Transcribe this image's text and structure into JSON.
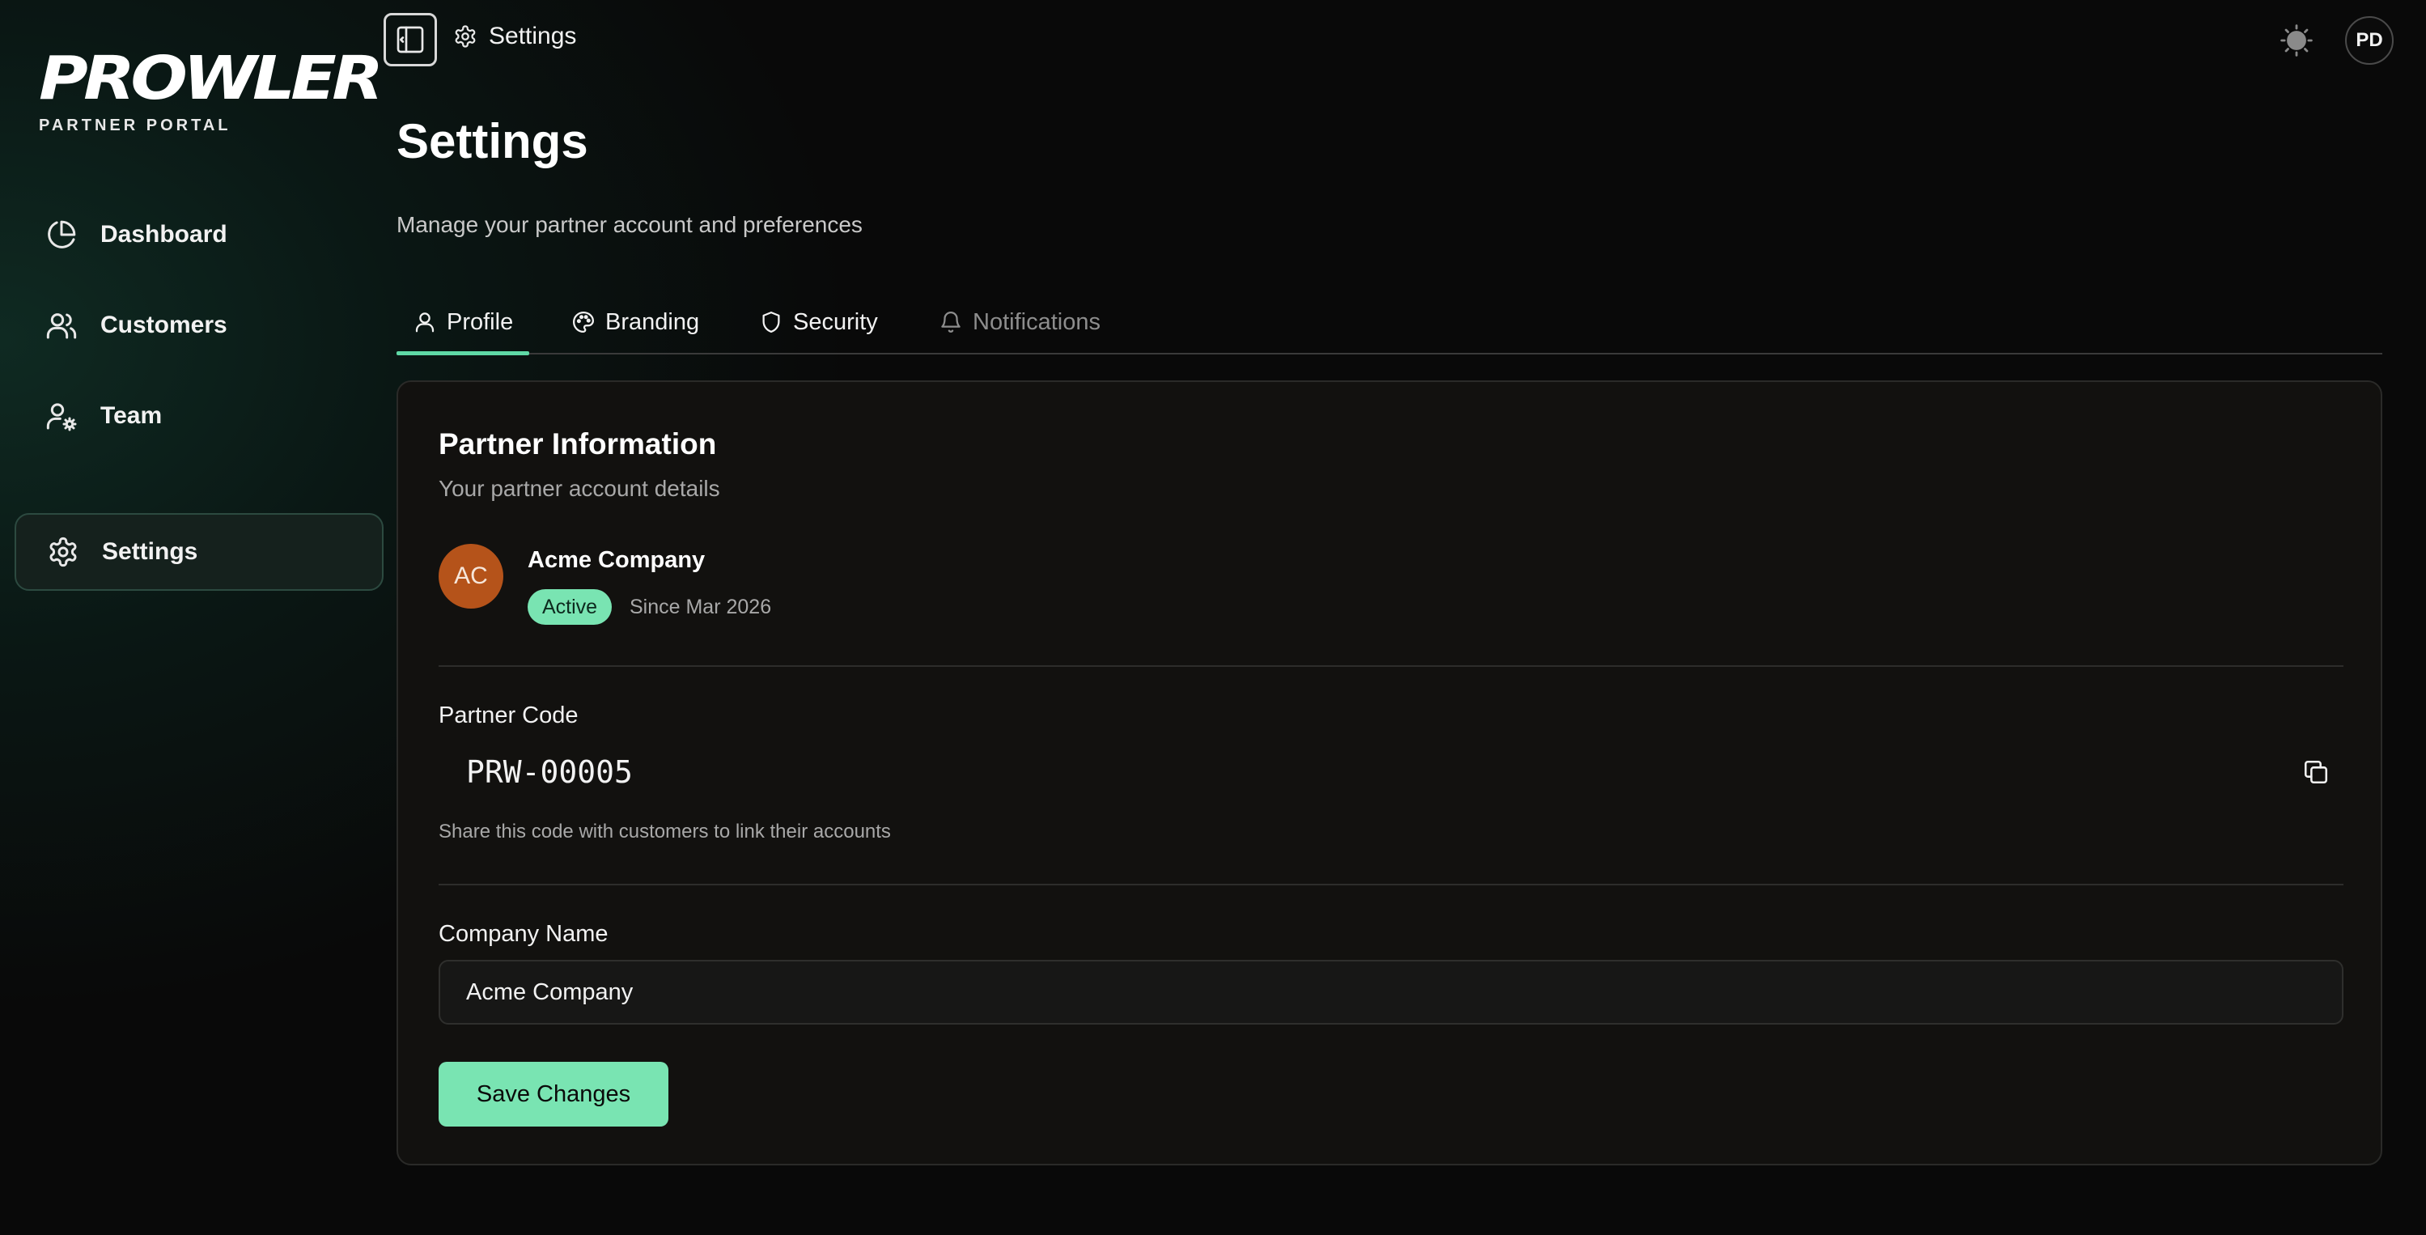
{
  "brand": {
    "name": "PROWLER",
    "subtitle": "PARTNER PORTAL"
  },
  "sidebar": {
    "items": [
      {
        "label": "Dashboard",
        "icon": "pie-chart-icon",
        "active": false
      },
      {
        "label": "Customers",
        "icon": "users-icon",
        "active": false
      },
      {
        "label": "Team",
        "icon": "user-cog-icon",
        "active": false
      },
      {
        "label": "Settings",
        "icon": "gear-icon",
        "active": true
      }
    ]
  },
  "header": {
    "breadcrumb": "Settings",
    "user_initials": "PD",
    "theme_icon": "sun-icon"
  },
  "page": {
    "title": "Settings",
    "subtitle": "Manage your partner account and preferences"
  },
  "tabs": [
    {
      "label": "Profile",
      "icon": "user-icon",
      "active": true,
      "disabled": false
    },
    {
      "label": "Branding",
      "icon": "palette-icon",
      "active": false,
      "disabled": false
    },
    {
      "label": "Security",
      "icon": "shield-icon",
      "active": false,
      "disabled": false
    },
    {
      "label": "Notifications",
      "icon": "bell-icon",
      "active": false,
      "disabled": true
    }
  ],
  "card": {
    "title": "Partner Information",
    "subtitle": "Your partner account details",
    "org": {
      "initials": "AC",
      "name": "Acme Company",
      "status": "Active",
      "since": "Since Mar 2026"
    },
    "partner_code": {
      "label": "Partner Code",
      "value": "PRW-00005",
      "hint": "Share this code with customers to link their accounts"
    },
    "company_name": {
      "label": "Company Name",
      "value": "Acme Company",
      "placeholder": ""
    },
    "save_label": "Save Changes"
  },
  "colors": {
    "accent": "#79e4b2",
    "tab_indicator": "#5fd9a6",
    "org_avatar": "#b5531a",
    "card_bg": "#12110f",
    "page_bg": "#090909"
  }
}
